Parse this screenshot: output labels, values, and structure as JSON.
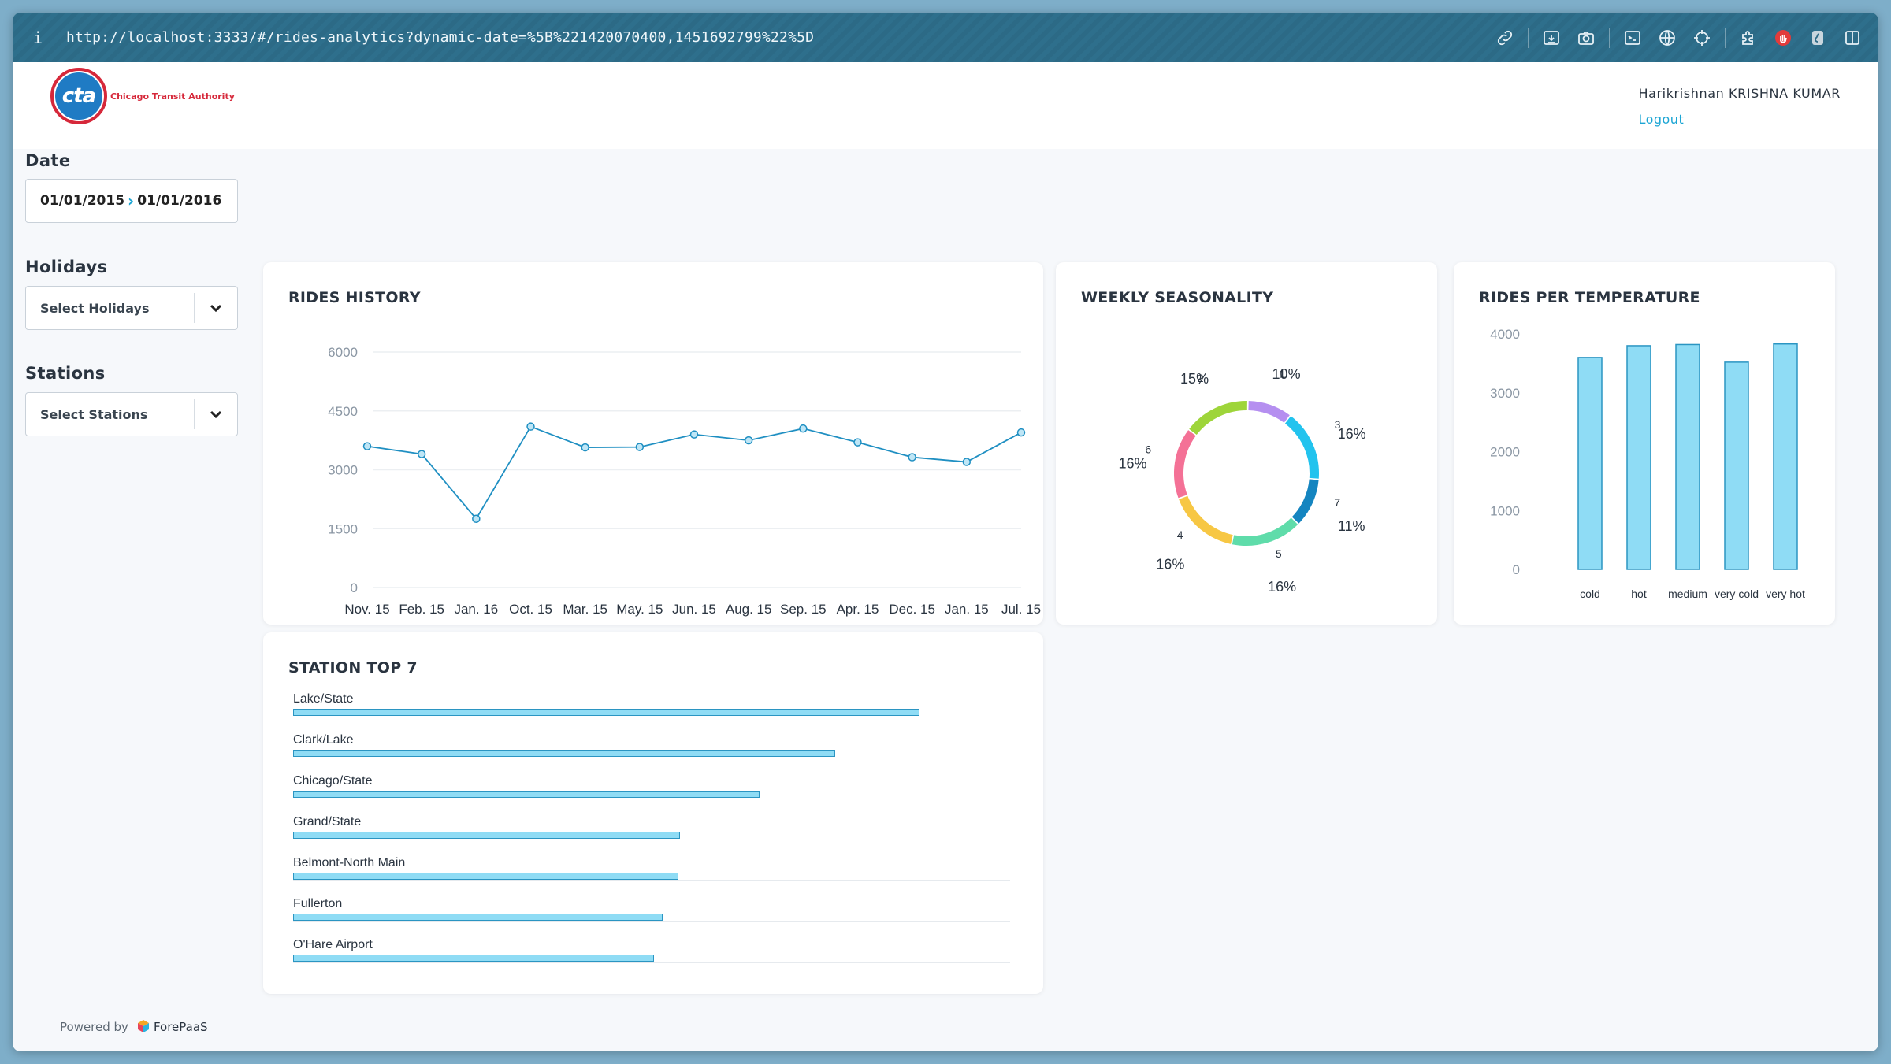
{
  "browser": {
    "info_label": "i",
    "url": "http://localhost:3333/#/rides-analytics?dynamic-date=%5B%221420070400,1451692799%22%5D"
  },
  "header": {
    "logo_mark": "cta",
    "logo_text": "Chicago Transit Authority",
    "user_name": "Harikrishnan KRISHNA KUMAR",
    "logout_label": "Logout"
  },
  "filters": {
    "date_label": "Date",
    "date_from": "01/01/2015",
    "date_to": "01/01/2016",
    "holidays_label": "Holidays",
    "holidays_placeholder": "Select Holidays",
    "stations_label": "Stations",
    "stations_placeholder": "Select Stations"
  },
  "footer": {
    "powered_by": "Powered by",
    "brand": "ForePaaS"
  },
  "cards": {
    "rides_history_title": "RIDES HISTORY",
    "weekly_title": "WEEKLY SEASONALITY",
    "temperature_title": "RIDES PER TEMPERATURE",
    "stations_title": "STATION TOP 7"
  },
  "colors": {
    "accent": "#1ba5d4",
    "line": "#1f8fc2",
    "bar_fill": "#8fdcf5",
    "bar_stroke": "#2b95c2"
  },
  "chart_data": [
    {
      "type": "line",
      "title": "RIDES HISTORY",
      "categories": [
        "Nov. 15",
        "Feb. 15",
        "Jan. 16",
        "Oct. 15",
        "Mar. 15",
        "May. 15",
        "Jun. 15",
        "Aug. 15",
        "Sep. 15",
        "Apr. 15",
        "Dec. 15",
        "Jan. 15",
        "Jul. 15"
      ],
      "values": [
        3600,
        3400,
        1750,
        4100,
        3570,
        3580,
        3900,
        3750,
        4050,
        3700,
        3320,
        3200,
        3950
      ],
      "ylim": [
        0,
        6000
      ],
      "yticks": [
        0,
        1500,
        3000,
        4500,
        6000
      ],
      "grid": true
    },
    {
      "type": "pie",
      "title": "WEEKLY SEASONALITY",
      "slices": [
        {
          "label": "1",
          "value": 10,
          "pct": "10%",
          "color": "#b58ff0"
        },
        {
          "label": "3",
          "value": 16,
          "pct": "16%",
          "color": "#22c3ee"
        },
        {
          "label": "7",
          "value": 11,
          "pct": "11%",
          "color": "#1585c0"
        },
        {
          "label": "5",
          "value": 16,
          "pct": "16%",
          "color": "#5fdcaa"
        },
        {
          "label": "4",
          "value": 16,
          "pct": "16%",
          "color": "#f7c744"
        },
        {
          "label": "6",
          "value": 16,
          "pct": "16%",
          "color": "#f47196"
        },
        {
          "label": "2",
          "value": 15,
          "pct": "15%",
          "color": "#9ed53a"
        }
      ]
    },
    {
      "type": "bar",
      "title": "RIDES PER TEMPERATURE",
      "categories": [
        "cold",
        "hot",
        "medium",
        "very cold",
        "very hot"
      ],
      "values": [
        3600,
        3800,
        3820,
        3520,
        3830
      ],
      "ylim": [
        0,
        4000
      ],
      "yticks": [
        0,
        1000,
        2000,
        3000,
        4000
      ]
    },
    {
      "type": "bar",
      "orientation": "horizontal",
      "title": "STATION TOP 7",
      "categories": [
        "Lake/State",
        "Clark/Lake",
        "Chicago/State",
        "Grand/State",
        "Belmont-North Main",
        "Fullerton",
        "O'Hare Airport"
      ],
      "values": [
        100,
        86.5,
        74.5,
        61.8,
        61.5,
        59,
        57.6
      ],
      "xlim": [
        0,
        100
      ]
    }
  ]
}
